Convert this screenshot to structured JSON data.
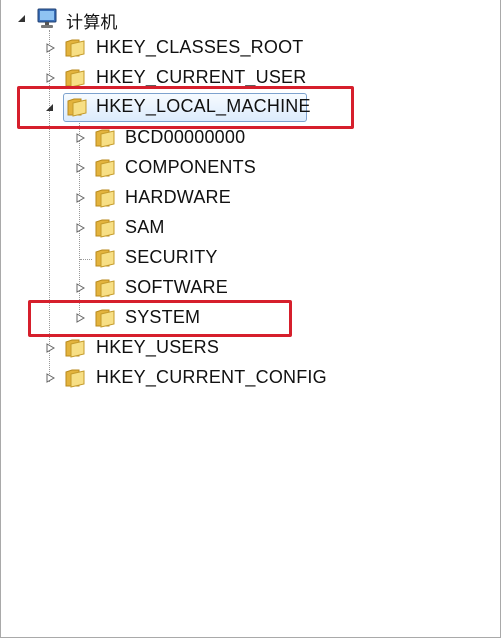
{
  "tree": {
    "root": {
      "label": "计算机",
      "icon": "computer-icon"
    },
    "hives": [
      "HKEY_CLASSES_ROOT",
      "HKEY_CURRENT_USER",
      "HKEY_LOCAL_MACHINE",
      "HKEY_USERS",
      "HKEY_CURRENT_CONFIG"
    ],
    "local_machine_children": [
      "BCD00000000",
      "COMPONENTS",
      "HARDWARE",
      "SAM",
      "SECURITY",
      "SOFTWARE",
      "SYSTEM"
    ],
    "selected": "HKEY_LOCAL_MACHINE"
  },
  "colors": {
    "highlight_box": "#d61f2c",
    "selection_border": "#7da2ce",
    "folder_fill": "#f2d36b"
  }
}
